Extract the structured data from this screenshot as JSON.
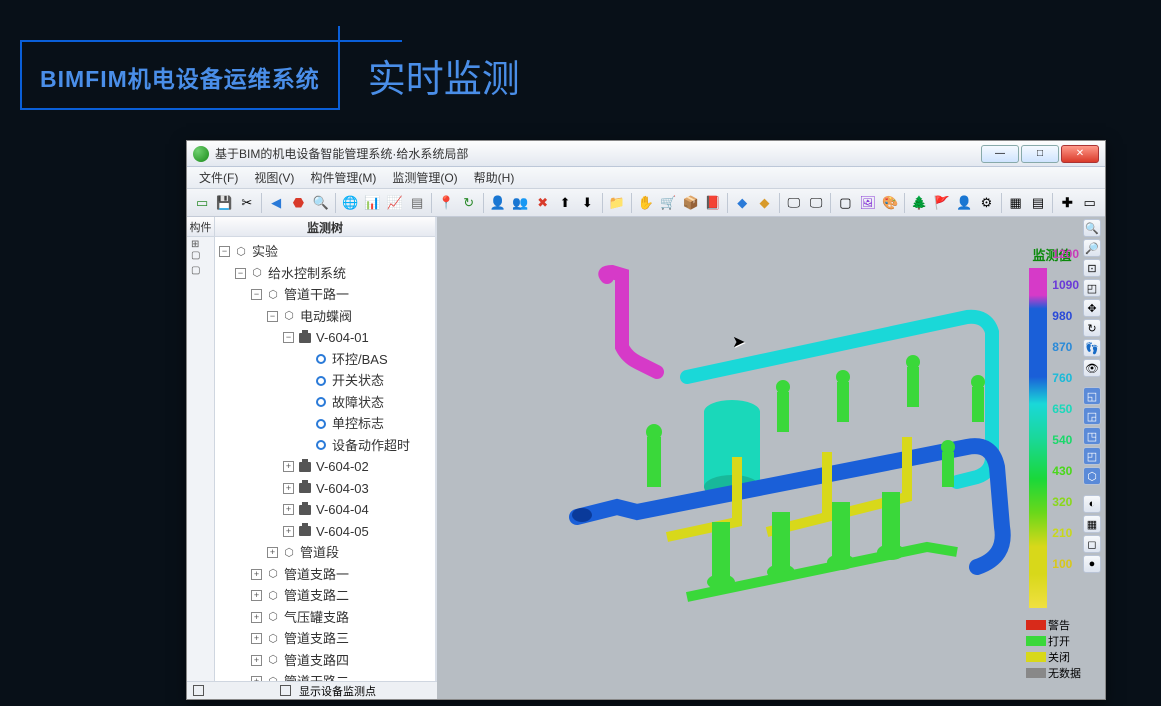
{
  "slide": {
    "brand": "BIMFIM机电设备运维系统",
    "title": "实时监测"
  },
  "window": {
    "title": "基于BIM的机电设备智能管理系统·给水系统局部"
  },
  "menus": {
    "file": "文件(F)",
    "view": "视图(V)",
    "component": "构件管理(M)",
    "monitor": "监测管理(O)",
    "help": "帮助(H)"
  },
  "leftcol": {
    "header": "构件",
    "r1": "⊞ ▢",
    "r2": "▢"
  },
  "tree": {
    "header": "监测树",
    "root": "实验",
    "l1": "给水控制系统",
    "l2": "管道干路一",
    "l3": "电动蝶阀",
    "v01": "V-604-01",
    "p1": "环控/BAS",
    "p2": "开关状态",
    "p3": "故障状态",
    "p4": "单控标志",
    "p5": "设备动作超时",
    "v02": "V-604-02",
    "v03": "V-604-03",
    "v04": "V-604-04",
    "v05": "V-604-05",
    "seg": "管道段",
    "b1": "管道支路一",
    "b2": "管道支路二",
    "b3": "气压罐支路",
    "b4": "管道支路三",
    "b5": "管道支路四",
    "b6": "管道干路二"
  },
  "legend": {
    "title": "监测值",
    "v1200": "1200",
    "v1090": "1090",
    "v980": "980",
    "v870": "870",
    "v760": "760",
    "v650": "650",
    "v540": "540",
    "v430": "430",
    "v320": "320",
    "v210": "210",
    "v100": "100",
    "alarm": "警告",
    "open": "打开",
    "close": "关闭",
    "invalid": "无数据"
  },
  "bottom": {
    "opt2": "显示设备监测点"
  },
  "colors": {
    "magenta": "#d63ac8",
    "blue": "#1a5fd8",
    "cyan": "#1ad8d8",
    "green": "#1ad83a",
    "lime": "#8ad81a",
    "yellow": "#d8d81a",
    "red": "#d82a1a"
  }
}
